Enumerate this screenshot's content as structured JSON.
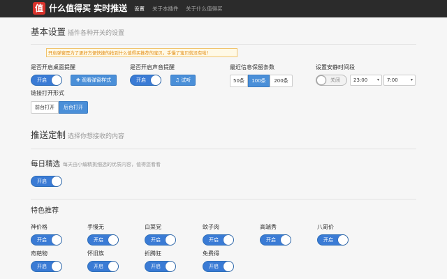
{
  "header": {
    "logo_char": "值",
    "brand": "什么值得买 实时推送",
    "nav": [
      "设置",
      "关于本插件",
      "关于什么值得买"
    ]
  },
  "basic": {
    "title": "基本设置",
    "subtitle": "插件各种开关的设置",
    "tip": "开启弹窗是为了更好方便快捷的抢到什么值得买推荐的宝贝。手慢了宝贝就没有啦！",
    "desktop_label": "是否开启桌面提醒",
    "desktop_toggle": "开启",
    "preview_btn": "✚ 观看弹窗样式",
    "sound_label": "是否开启声音提醒",
    "sound_toggle": "开启",
    "listen_btn": "♫ 试听",
    "keep_label": "最近信息保留条数",
    "keep_options": [
      "50条",
      "100条",
      "200条"
    ],
    "quiet_label": "设置安静时间段",
    "quiet_toggle": "关闭",
    "quiet_start": "23:00",
    "quiet_end": "7:00",
    "link_label": "链接打开形式",
    "link_options": [
      "前台打开",
      "后台打开"
    ]
  },
  "push": {
    "title": "推送定制",
    "subtitle": "选择你想接收的内容",
    "daily_title": "每日精选",
    "daily_subtitle": "每天由小编精挑细选的优质内容，值得您看看",
    "daily_toggle": "开启",
    "feature_title": "特色推荐",
    "features": [
      {
        "name": "神价格",
        "toggle": "开启"
      },
      {
        "name": "手慢无",
        "toggle": "开启"
      },
      {
        "name": "白菜党",
        "toggle": "开启"
      },
      {
        "name": "蚊子肉",
        "toggle": "开启"
      },
      {
        "name": "高端秀",
        "toggle": "开启"
      },
      {
        "name": "八哥价",
        "toggle": "开启"
      },
      {
        "name": "奇葩物",
        "toggle": "开启"
      },
      {
        "name": "怀旧族",
        "toggle": "开启"
      },
      {
        "name": "折腾狂",
        "toggle": "开启"
      },
      {
        "name": "免费得",
        "toggle": "开启"
      }
    ]
  }
}
